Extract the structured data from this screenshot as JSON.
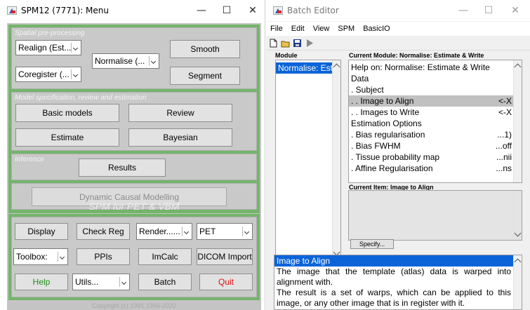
{
  "spm_window": {
    "title": "SPM12 (7771): Menu",
    "win_buttons": {
      "minimize": "—",
      "maximize": "☐",
      "close": "✕"
    },
    "spatial": {
      "label": "Spatial pre-processing",
      "realign": "Realign (Est...",
      "coregister": "Coregister (...",
      "normalise": "Normalise (...",
      "smooth": "Smooth",
      "segment": "Segment"
    },
    "model": {
      "label": "Model specification, review and estimation",
      "basic_models": "Basic models",
      "review": "Review",
      "estimate": "Estimate",
      "bayesian": "Bayesian"
    },
    "inference": {
      "label": "Inference",
      "results": "Results"
    },
    "dcm": "Dynamic Causal Modelling",
    "heading": "SPM for PET & VBM",
    "tools": {
      "display": "Display",
      "check_reg": "Check Reg",
      "render": "Render......",
      "modality": "PET",
      "toolbox": "Toolbox:",
      "ppis": "PPIs",
      "imcalc": "ImCalc",
      "dicom_import": "DICOM Import",
      "help": "Help",
      "utils": "Utils...",
      "batch": "Batch",
      "quit": "Quit"
    },
    "copyright": "Copyright (c) 1991,1994-2020"
  },
  "batch_window": {
    "title": "Batch Editor",
    "menu": [
      "File",
      "Edit",
      "View",
      "SPM",
      "BasicIO"
    ],
    "module_head": "Module",
    "module_item": "Normalise: Est",
    "current_module_head": "Current Module: Normalise: Estimate & Write",
    "module_rows": [
      {
        "label": "Help on: Normalise: Estimate & Write",
        "value": ""
      },
      {
        "label": "Data",
        "value": ""
      },
      {
        "label": ". Subject",
        "value": ""
      },
      {
        "label": ". . Image to Align",
        "value": "<-X"
      },
      {
        "label": ". . Images to Write",
        "value": "<-X"
      },
      {
        "label": "Estimation Options",
        "value": ""
      },
      {
        "label": ". Bias regularisation",
        "value": "...1)"
      },
      {
        "label": ". Bias FWHM",
        "value": "...off"
      },
      {
        "label": ". Tissue probability map",
        "value": "...nii"
      },
      {
        "label": ". Affine Regularisation",
        "value": "...ns"
      }
    ],
    "current_item_head": "Current Item: Image to Align",
    "specify": "Specify...",
    "help_title": "Image to Align",
    "help_p1": "The image that the template (atlas) data is warped into alignment with.",
    "help_p2": "The result is a set of warps, which can be applied to this image, or any other image that is in register with it."
  }
}
